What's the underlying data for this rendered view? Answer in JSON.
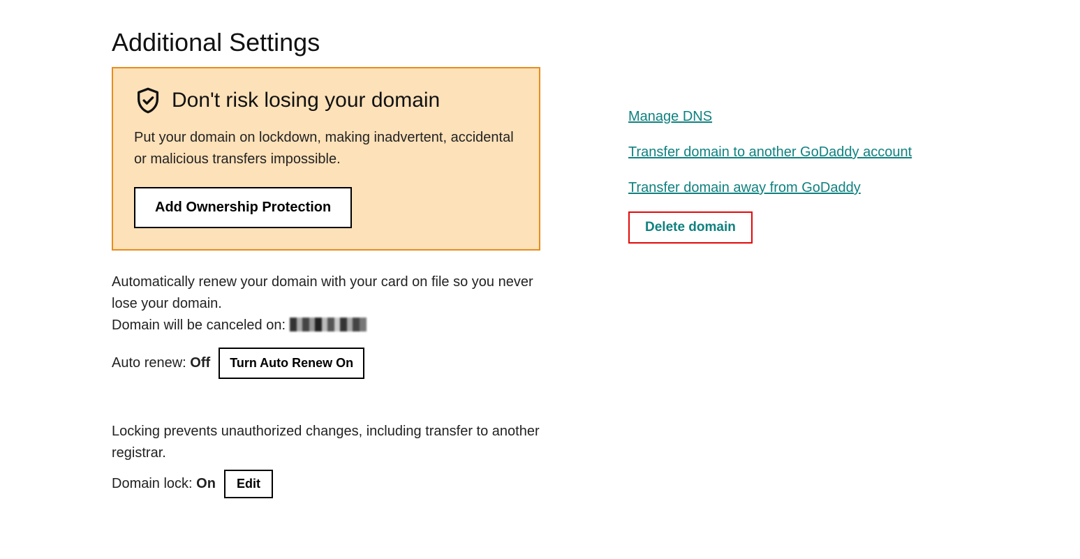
{
  "heading": "Additional Settings",
  "warning": {
    "title": "Don't risk losing your domain",
    "description": "Put your domain on lockdown, making inadvertent, accidental or malicious transfers impossible.",
    "button": "Add Ownership Protection"
  },
  "auto_renew": {
    "description": "Automatically renew your domain with your card on file so you never lose your domain.",
    "cancel_prefix": "Domain will be canceled on: ",
    "label": "Auto renew:",
    "value": "Off",
    "button": "Turn Auto Renew On"
  },
  "domain_lock": {
    "description": "Locking prevents unauthorized changes, including transfer to another registrar.",
    "label": "Domain lock:",
    "value": "On",
    "button": "Edit"
  },
  "links": {
    "manage_dns": "Manage DNS",
    "transfer_account": "Transfer domain to another GoDaddy account",
    "transfer_away": "Transfer domain away from GoDaddy",
    "delete": "Delete domain"
  }
}
